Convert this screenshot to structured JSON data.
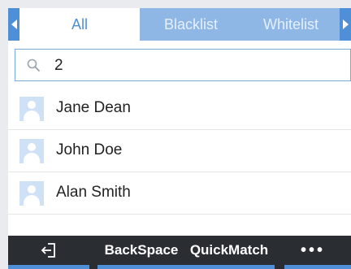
{
  "tabs": {
    "items": [
      {
        "label": "All",
        "active": true
      },
      {
        "label": "Blacklist",
        "active": false
      },
      {
        "label": "Whitelist",
        "active": false
      }
    ]
  },
  "search": {
    "value": "2",
    "icon": "search-icon"
  },
  "contacts": [
    {
      "name": "Jane Dean"
    },
    {
      "name": "John Doe"
    },
    {
      "name": "Alan Smith"
    }
  ],
  "softkeys": {
    "back_icon": "exit-icon",
    "backspace_label": "BackSpace",
    "quickmatch_label": "QuickMatch",
    "more_label": "•••"
  },
  "colors": {
    "accent": "#4f8fd8",
    "tabbar_bg": "#8fb7e6",
    "softkey_bg": "#2a2e33"
  }
}
